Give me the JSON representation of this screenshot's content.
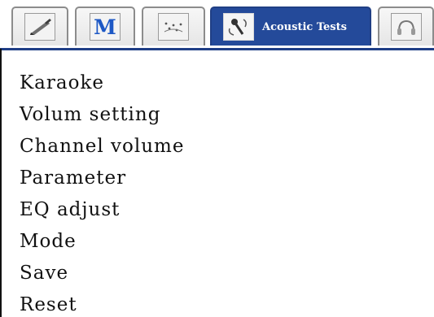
{
  "tabs": [
    {
      "icon": "pen-icon",
      "label": ""
    },
    {
      "icon": "m-letter-icon",
      "label": "M"
    },
    {
      "icon": "speaker-dots-icon",
      "label": ""
    },
    {
      "icon": "microphone-icon",
      "label": "Acoustic Tests",
      "active": true
    },
    {
      "icon": "headphones-icon",
      "label": ""
    }
  ],
  "menu": {
    "items": [
      "Karaoke",
      "Volum setting",
      "Channel volume",
      "Parameter",
      "EQ adjust",
      "Mode",
      "Save",
      "Reset"
    ]
  },
  "colors": {
    "active_tab": "#244a9a",
    "tab_border": "#8c8c8c",
    "text": "#111111"
  }
}
